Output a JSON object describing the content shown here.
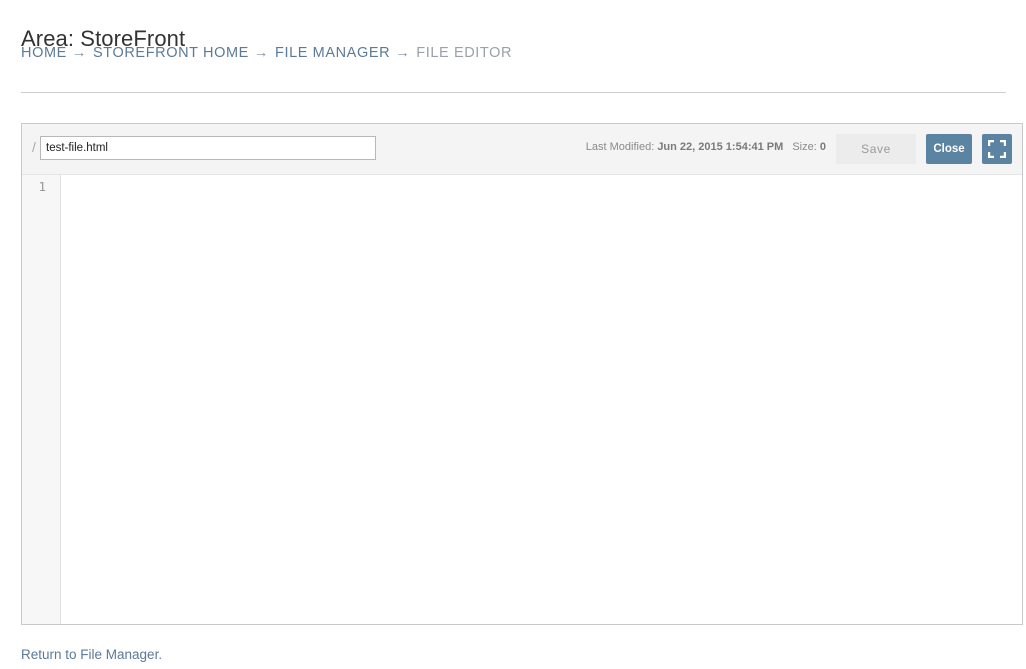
{
  "header": {
    "title": "Area: StoreFront"
  },
  "breadcrumb": {
    "items": [
      "HOME",
      "STOREFRONT HOME",
      "FILE MANAGER"
    ],
    "current": "FILE EDITOR",
    "separator": "→"
  },
  "editor": {
    "path_prefix": "/",
    "filename": "test-file.html",
    "last_modified_label": "Last Modified:",
    "last_modified_value": "Jun 22, 2015 1:54:41 PM",
    "size_label": "Size:",
    "size_value": "0",
    "save_label": "Save",
    "close_label": "Close",
    "fullscreen_icon": "expand-icon",
    "line_numbers": [
      "1"
    ]
  },
  "footer": {
    "return_link": "Return to File Manager."
  },
  "colors": {
    "accent": "#5a84a2",
    "link": "#5b7a98"
  }
}
